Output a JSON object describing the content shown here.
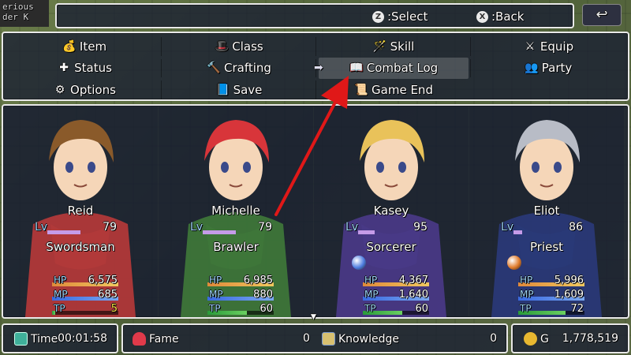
{
  "map": {
    "sign_line1": "erious",
    "sign_line2": "der K"
  },
  "help": {
    "select_glyph": "Z",
    "select_label": ":Select",
    "back_glyph": "X",
    "back_label": ":Back",
    "return_icon": "return-arrow-icon",
    "return_glyph": "↩"
  },
  "commands": [
    {
      "label": "Item",
      "icon": "money-bag-icon",
      "glyph": "💰"
    },
    {
      "label": "Class",
      "icon": "wizard-hat-icon",
      "glyph": "🎩"
    },
    {
      "label": "Skill",
      "icon": "magic-wand-icon",
      "glyph": "🪄"
    },
    {
      "label": "Equip",
      "icon": "equipment-icon",
      "glyph": "⚔"
    },
    {
      "label": "Status",
      "icon": "status-icon",
      "glyph": "✚"
    },
    {
      "label": "Crafting",
      "icon": "hammer-icon",
      "glyph": "🔨"
    },
    {
      "label": "Combat Log",
      "icon": "open-book-icon",
      "glyph": "📖",
      "selected": true
    },
    {
      "label": "Party",
      "icon": "party-icon",
      "glyph": "👥"
    },
    {
      "label": "Options",
      "icon": "gear-icon",
      "glyph": "⚙"
    },
    {
      "label": "Save",
      "icon": "save-book-icon",
      "glyph": "📘"
    },
    {
      "label": "Game End",
      "icon": "scroll-icon",
      "glyph": "📜"
    }
  ],
  "cursor_glyph": "➡",
  "actors": [
    {
      "name": "Reid",
      "lv_label": "Lv",
      "level": "79",
      "lv_progress": 0.6,
      "class": "Swordsman",
      "hp_label": "HP",
      "hp": "6,575",
      "hp_ratio": 1.0,
      "mp_label": "MP",
      "mp": "685",
      "mp_ratio": 1.0,
      "tp_label": "TP",
      "tp": "5",
      "tp_ratio": 0.05,
      "state_color": "",
      "hair": "#8a5a2a",
      "cloth": "#b83a3a",
      "skin": "#f5d6b8"
    },
    {
      "name": "Michelle",
      "lv_label": "Lv",
      "level": "79",
      "lv_progress": 0.6,
      "class": "Brawler",
      "hp_label": "HP",
      "hp": "6,985",
      "hp_ratio": 1.0,
      "mp_label": "MP",
      "mp": "880",
      "mp_ratio": 1.0,
      "tp_label": "TP",
      "tp": "60",
      "tp_ratio": 0.6,
      "state_color": "",
      "hair": "#d8353a",
      "cloth": "#3f7a3a",
      "skin": "#f5d6b8"
    },
    {
      "name": "Kasey",
      "lv_label": "Lv",
      "level": "95",
      "lv_progress": 0.3,
      "class": "Sorcerer",
      "hp_label": "HP",
      "hp": "4,367",
      "hp_ratio": 1.0,
      "mp_label": "MP",
      "mp": "1,640",
      "mp_ratio": 1.0,
      "tp_label": "TP",
      "tp": "60",
      "tp_ratio": 0.6,
      "state_color": "#4d7de0",
      "hair": "#e9c25a",
      "cloth": "#4a3a8a",
      "skin": "#f5d6b8"
    },
    {
      "name": "Eliot",
      "lv_label": "Lv",
      "level": "86",
      "lv_progress": 0.15,
      "class": "Priest",
      "hp_label": "HP",
      "hp": "5,996",
      "hp_ratio": 1.0,
      "mp_label": "MP",
      "mp": "1,609",
      "mp_ratio": 1.0,
      "tp_label": "TP",
      "tp": "72",
      "tp_ratio": 0.72,
      "state_color": "#e07a2a",
      "hair": "#b8bcc6",
      "cloth": "#2a3a7a",
      "skin": "#f5d6b8"
    }
  ],
  "footer": {
    "time_label": "Time",
    "time_value": "00:01:58",
    "time_icon": "clock-icon",
    "fame_label": "Fame",
    "fame_value": "0",
    "fame_icon": "heart-icon",
    "knowledge_label": "Knowledge",
    "knowledge_value": "0",
    "knowledge_icon": "map-icon",
    "gold_label": "G",
    "gold_value": "1,778,519",
    "gold_icon": "coins-icon"
  },
  "colors": {
    "hp_gradient": [
      "#e08a3a",
      "#f0c860"
    ],
    "mp_gradient": [
      "#3a6ae0",
      "#7aa8f0"
    ],
    "tp_gradient": [
      "#2a9a3a",
      "#6ad060"
    ],
    "arrow": "#e01818"
  }
}
